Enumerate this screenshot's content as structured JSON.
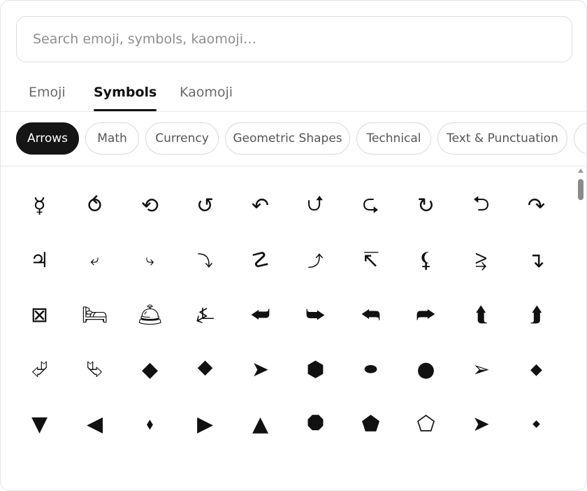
{
  "search": {
    "placeholder": "Search emoji, symbols, kaomoji…",
    "value": ""
  },
  "tabs": [
    {
      "label": "Emoji",
      "active": false
    },
    {
      "label": "Symbols",
      "active": true
    },
    {
      "label": "Kaomoji",
      "active": false
    }
  ],
  "categories": [
    {
      "label": "Arrows",
      "active": true
    },
    {
      "label": "Math",
      "active": false
    },
    {
      "label": "Currency",
      "active": false
    },
    {
      "label": "Geometric Shapes",
      "active": false
    },
    {
      "label": "Technical",
      "active": false
    },
    {
      "label": "Text & Punctuation",
      "active": false
    }
  ],
  "symbols": [
    "☿",
    "⥀",
    "⟲",
    "↺",
    "↶",
    "⮍",
    "⮎",
    "↻",
    "⮌",
    "↷",
    "♃",
    "⤶",
    "⤷",
    "⤵",
    "☡",
    "⤴",
    "↸",
    "⚸",
    "⥸",
    "↴",
    "⊠",
    "🛏",
    "🛎",
    "⍼",
    "⮨",
    "⮩",
    "⮪",
    "⮫",
    "⮬",
    "⮭",
    "⮰",
    "⮱",
    "◆",
    "⯁",
    "➤",
    "⬢",
    "⬬",
    "●",
    "➢",
    "◆",
    "▼",
    "◀",
    "⬧",
    "▶",
    "▲",
    "⯃",
    "⬟",
    "⬠",
    "➤",
    "◆"
  ],
  "symbol_sizes": [
    "n",
    "n",
    "n",
    "n",
    "n",
    "n",
    "n",
    "n",
    "n",
    "n",
    "n",
    "sm",
    "sm",
    "sm",
    "n",
    "sm",
    "n",
    "n",
    "n",
    "n",
    "n",
    "n",
    "n",
    "n",
    "n",
    "n",
    "n",
    "n",
    "n",
    "n",
    "n",
    "n",
    "n",
    "n",
    "n",
    "n",
    "sm",
    "n",
    "n",
    "sm",
    "n",
    "n",
    "sm",
    "n",
    "n",
    "n",
    "n",
    "n",
    "n",
    "xs"
  ]
}
